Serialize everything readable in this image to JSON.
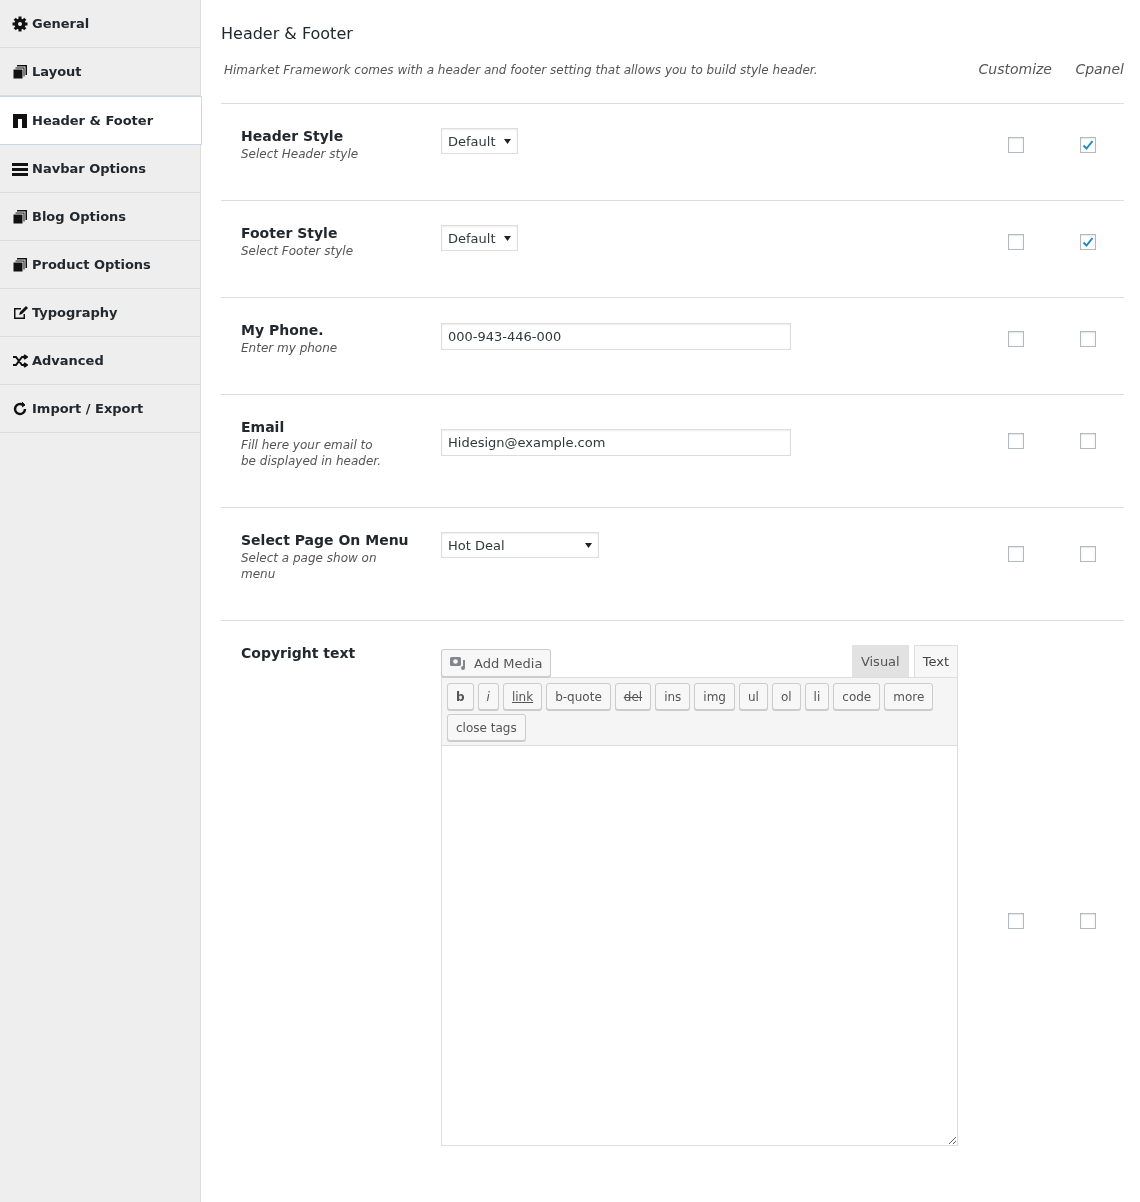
{
  "sidebar": {
    "items": [
      {
        "label": "General",
        "selected": false
      },
      {
        "label": "Layout",
        "selected": false
      },
      {
        "label": "Header & Footer",
        "selected": true
      },
      {
        "label": "Navbar Options",
        "selected": false
      },
      {
        "label": "Blog Options",
        "selected": false
      },
      {
        "label": "Product Options",
        "selected": false
      },
      {
        "label": "Typography",
        "selected": false
      },
      {
        "label": "Advanced",
        "selected": false
      },
      {
        "label": "Import / Export",
        "selected": false
      }
    ]
  },
  "page": {
    "title": "Header & Footer",
    "description": "Himarket Framework comes with a header and footer setting that allows you to build style header.",
    "columns": [
      "Customize",
      "Cpanel"
    ]
  },
  "settings": [
    {
      "label": "Header Style",
      "hint": "Select Header style",
      "field": {
        "kind": "select",
        "value": "Default"
      },
      "customize": false,
      "cpanel": true
    },
    {
      "label": "Footer Style",
      "hint": "Select Footer style",
      "field": {
        "kind": "select",
        "value": "Default"
      },
      "customize": false,
      "cpanel": true
    },
    {
      "label": "My Phone.",
      "hint": "Enter my phone",
      "field": {
        "kind": "text",
        "value": "000-943-446-000"
      },
      "customize": false,
      "cpanel": false
    },
    {
      "label": "Email",
      "hint": "Fill here your email to be displayed in header.",
      "field": {
        "kind": "text",
        "value": "Hidesign@example.com"
      },
      "customize": false,
      "cpanel": false
    },
    {
      "label": "Select Page On Menu",
      "hint": "Select a page show on menu",
      "field": {
        "kind": "select",
        "value": "Hot Deal"
      },
      "customize": false,
      "cpanel": false
    },
    {
      "label": "Copyright text",
      "field": {
        "kind": "editor",
        "add_media": "Add Media",
        "tabs": [
          {
            "label": "Visual",
            "selected": false
          },
          {
            "label": "Text",
            "selected": true
          }
        ],
        "quicktags": [
          {
            "label": "b",
            "kind": "bold"
          },
          {
            "label": "i",
            "kind": "italic"
          },
          {
            "label": "link",
            "kind": "link"
          },
          {
            "label": "b-quote",
            "kind": "plain"
          },
          {
            "label": "del",
            "kind": "strike"
          },
          {
            "label": "ins",
            "kind": "plain"
          },
          {
            "label": "img",
            "kind": "plain"
          },
          {
            "label": "ul",
            "kind": "plain"
          },
          {
            "label": "ol",
            "kind": "plain"
          },
          {
            "label": "li",
            "kind": "plain"
          },
          {
            "label": "code",
            "kind": "plain"
          },
          {
            "label": "more",
            "kind": "plain"
          },
          {
            "label": "close tags",
            "kind": "plain"
          }
        ]
      },
      "customize": false,
      "cpanel": false
    }
  ]
}
